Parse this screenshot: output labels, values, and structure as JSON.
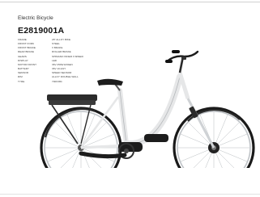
{
  "product": {
    "category": "Electric Bicycle",
    "model": "E2819001A"
  },
  "specs": [
    {
      "label": "FRAME",
      "value": "28\" ALLOY BIKE"
    },
    {
      "label": "FRONT FORK",
      "value": "STEEL"
    },
    {
      "label": "FRONT BRAKE",
      "value": "V BRAKE"
    },
    {
      "label": "REAR BRAKE",
      "value": "ROLLER BRAKE"
    },
    {
      "label": "GEARS",
      "value": "SHIMANO INNER 3 SPEED"
    },
    {
      "label": "DISPLAY",
      "value": "LED"
    },
    {
      "label": "MOTOR FRONT",
      "value": "36V 250W ESSEN"
    },
    {
      "label": "BATTERY",
      "value": "36V 10.4AH"
    },
    {
      "label": "SENSOR",
      "value": "SPEED SENSOR"
    },
    {
      "label": "RIM",
      "value": "ALLOY DOUBLE WALL"
    },
    {
      "label": "TYRE",
      "value": "700X38C"
    }
  ],
  "colors": {
    "frame": "#e6e7e8",
    "frame_dark": "#1c1c1c",
    "tyre": "#1a1a1a",
    "rim": "#bfc3c7"
  }
}
